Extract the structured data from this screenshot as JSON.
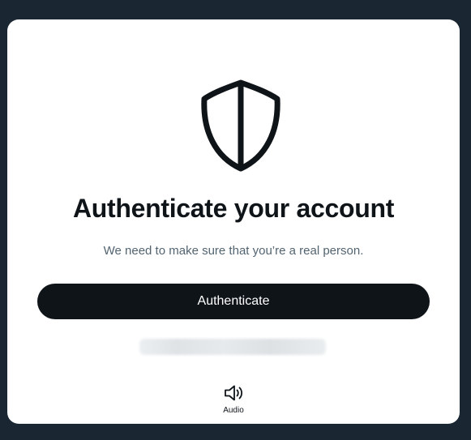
{
  "dialog": {
    "title": "Authenticate your account",
    "subtitle": "We need to make sure that you’re a real person.",
    "primary_button_label": "Authenticate",
    "audio_label": "Audio",
    "icon": "shield-icon"
  },
  "colors": {
    "page_background": "#1b2633",
    "card_background": "#ffffff",
    "primary_text": "#0f1419",
    "secondary_text": "#536471",
    "button_background": "#0f1419",
    "button_text": "#ffffff"
  }
}
